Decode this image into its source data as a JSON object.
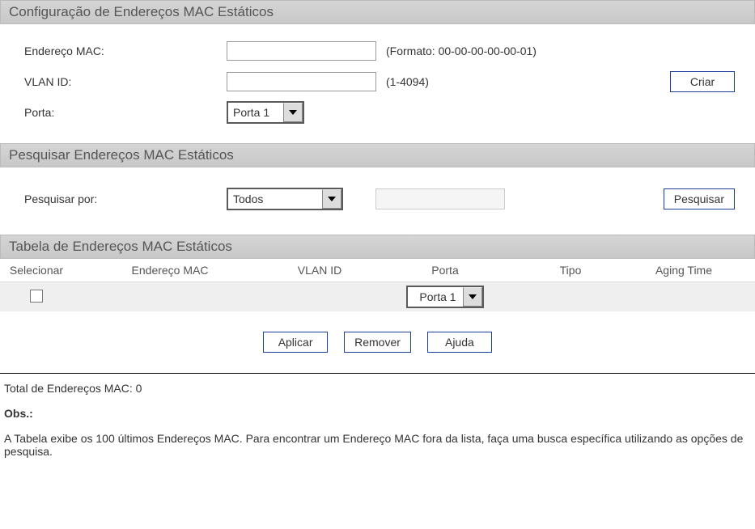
{
  "config": {
    "title": "Configuração de Endereços MAC Estáticos",
    "mac_label": "Endereço MAC:",
    "mac_value": "",
    "mac_hint": "(Formato: 00-00-00-00-00-01)",
    "vlan_label": "VLAN ID:",
    "vlan_value": "",
    "vlan_hint": "(1-4094)",
    "port_label": "Porta:",
    "port_value": "Porta 1",
    "create_btn": "Criar"
  },
  "search": {
    "title": "Pesquisar Endereços MAC Estáticos",
    "search_by_label": "Pesquisar por:",
    "search_by_value": "Todos",
    "search_input_value": "",
    "search_btn": "Pesquisar"
  },
  "table": {
    "title": "Tabela de Endereços MAC Estáticos",
    "columns": {
      "select": "Selecionar",
      "mac": "Endereço MAC",
      "vlan": "VLAN ID",
      "port": "Porta",
      "type": "Tipo",
      "aging": "Aging Time"
    },
    "row": {
      "mac": "",
      "vlan": "",
      "port": "Porta 1",
      "type": "",
      "aging": ""
    },
    "apply_btn": "Aplicar",
    "remove_btn": "Remover",
    "help_btn": "Ajuda"
  },
  "footer": {
    "total": "Total de Endereços MAC: 0",
    "obs_label": "Obs.:",
    "obs_text": "A Tabela exibe os 100 últimos Endereços MAC. Para encontrar um Endereço MAC fora da lista, faça uma busca específica utilizando as opções de pesquisa."
  }
}
